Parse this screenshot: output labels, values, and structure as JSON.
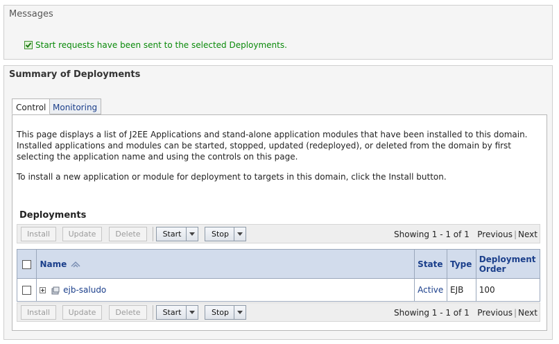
{
  "messages": {
    "title": "Messages",
    "text": "Start requests have been sent to the selected Deployments."
  },
  "summary": {
    "title": "Summary of Deployments",
    "tabs": [
      {
        "label": "Control"
      },
      {
        "label": "Monitoring"
      }
    ],
    "description": "This page displays a list of J2EE Applications and stand-alone application modules that have been installed to this domain. Installed applications and modules can be started, stopped, updated (redeployed), or deleted from the domain by first selecting the application name and using the controls on this page.",
    "install_hint": "To install a new application or module for deployment to targets in this domain, click the Install button."
  },
  "deployments": {
    "title": "Deployments",
    "buttons": {
      "install": "Install",
      "update": "Update",
      "delete": "Delete",
      "start": "Start",
      "stop": "Stop"
    },
    "pager": {
      "showing": "Showing 1 - 1 of 1",
      "previous": "Previous",
      "next": "Next"
    },
    "columns": {
      "name": "Name",
      "state": "State",
      "type": "Type",
      "order": "Deployment Order"
    },
    "rows": [
      {
        "name": "ejb-saludo",
        "state": "Active",
        "type": "EJB",
        "order": "100"
      }
    ]
  },
  "colors": {
    "success": "#0a8a0a",
    "link": "#1b3f8b",
    "header_bg": "#d2dcec"
  }
}
